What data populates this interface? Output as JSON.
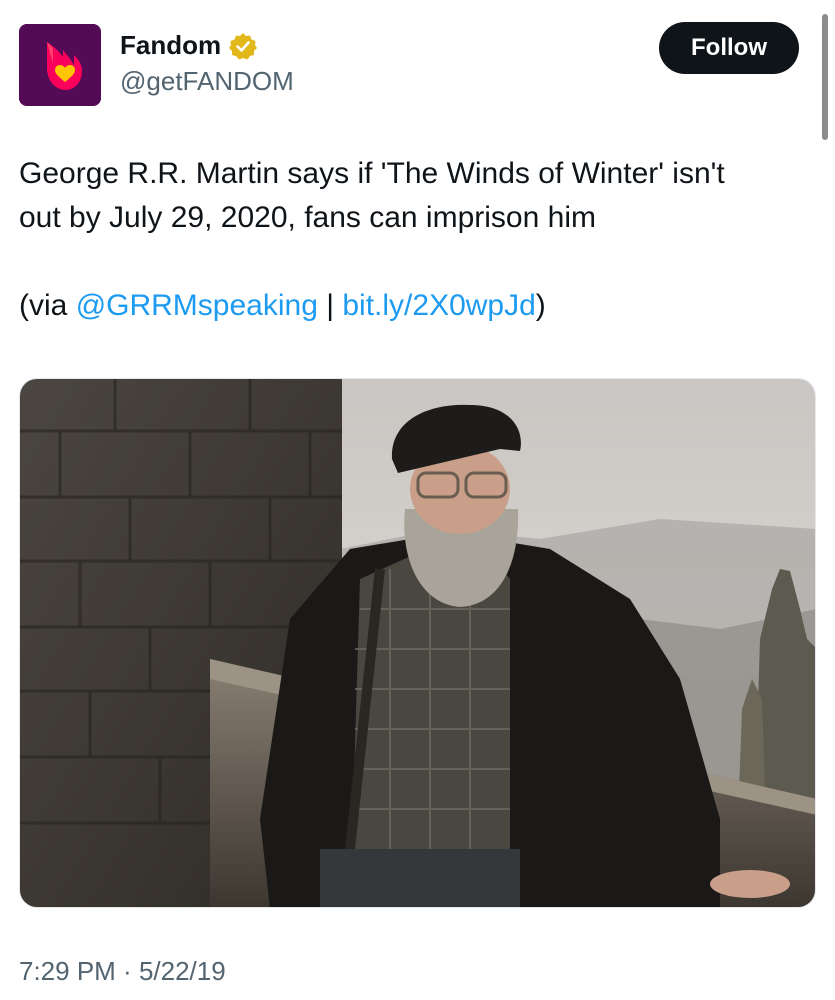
{
  "header": {
    "display_name": "Fandom",
    "handle": "@getFANDOM",
    "follow_label": "Follow",
    "verified_color": "#e2b719",
    "avatar_icon": "fandom-flame-heart-icon"
  },
  "tweet": {
    "line1": "George R.R. Martin says if 'The Winds of Winter' isn't",
    "line2": "out by July 29, 2020, fans can imprison him",
    "via_open": "(via ",
    "mention": "@GRRMspeaking",
    "separator": " | ",
    "url": "bit.ly/2X0wpJd",
    "via_close": ")",
    "link_color": "#1d9bf0"
  },
  "media": {
    "image_icon": "photo-man-in-cap-on-castle-balcony"
  },
  "meta": {
    "time": "7:29 PM",
    "dot": " · ",
    "date": "5/22/19"
  }
}
